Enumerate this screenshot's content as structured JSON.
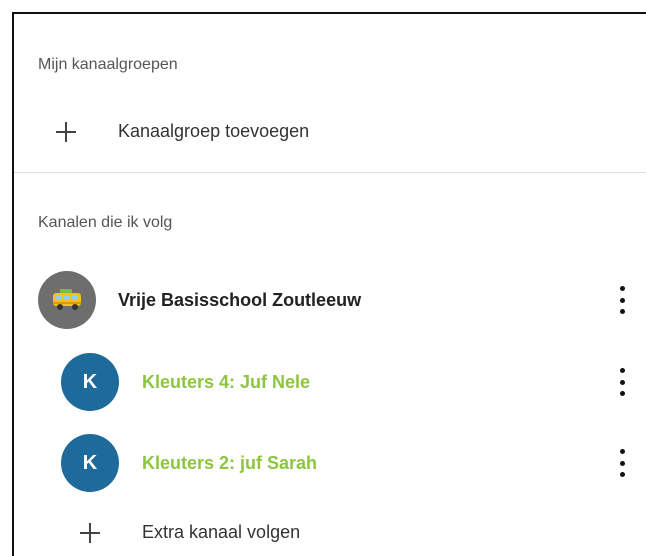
{
  "my_groups": {
    "title": "Mijn kanaalgroepen",
    "add_label": "Kanaalgroep toevoegen"
  },
  "following": {
    "title": "Kanalen die ik volg",
    "school": {
      "name": "Vrije Basisschool Zoutleeuw",
      "avatar_icon": "bus-icon"
    },
    "channels": [
      {
        "avatar_letter": "K",
        "name": "Kleuters 4: Juf Nele"
      },
      {
        "avatar_letter": "K",
        "name": "Kleuters 2: juf Sarah"
      }
    ],
    "extra_label": "Extra kanaal volgen"
  },
  "colors": {
    "channel_name": "#8cc63f",
    "avatar_k": "#1e6b9b",
    "avatar_school": "#6e6e6e"
  }
}
